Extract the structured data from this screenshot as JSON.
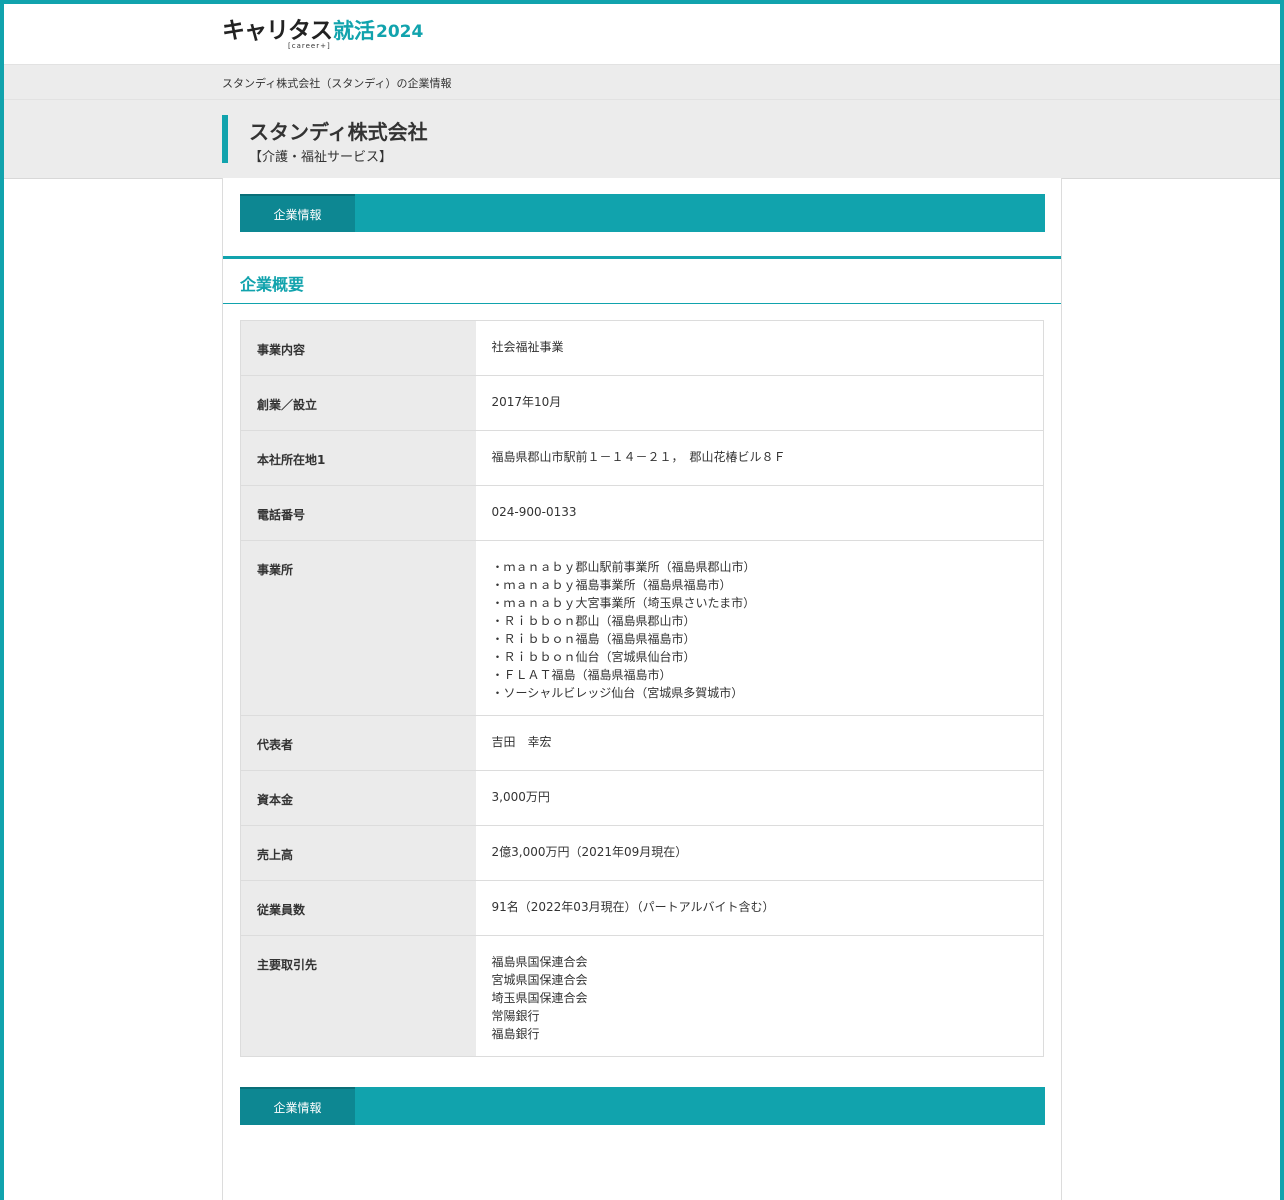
{
  "logo": {
    "main": "キャリタス",
    "sub": "[career+]",
    "accent": "就活",
    "year": "2024"
  },
  "breadcrumb": "スタンディ株式会社（スタンディ）の企業情報",
  "company": {
    "name": "スタンディ株式会社",
    "industry": "【介護・福祉サービス】"
  },
  "tabs": {
    "top": {
      "active": "企業情報"
    },
    "bottom": {
      "active": "企業情報"
    }
  },
  "section_title": "企業概要",
  "rows": [
    {
      "label": "事業内容",
      "value": "社会福祉事業"
    },
    {
      "label": "創業／設立",
      "value": "2017年10月"
    },
    {
      "label": "本社所在地1",
      "value": "福島県郡山市駅前１－１４－２１，　郡山花椿ビル８Ｆ"
    },
    {
      "label": "電話番号",
      "value": "024-900-0133"
    },
    {
      "label": "事業所",
      "lines": [
        "・ｍａｎａｂｙ郡山駅前事業所（福島県郡山市）",
        "・ｍａｎａｂｙ福島事業所（福島県福島市）",
        "・ｍａｎａｂｙ大宮事業所（埼玉県さいたま市）",
        "・Ｒｉｂｂｏｎ郡山（福島県郡山市）",
        "・Ｒｉｂｂｏｎ福島（福島県福島市）",
        "・Ｒｉｂｂｏｎ仙台（宮城県仙台市）",
        "・ＦＬＡＴ福島（福島県福島市）",
        "・ソーシャルビレッジ仙台（宮城県多賀城市）"
      ]
    },
    {
      "label": "代表者",
      "value": "吉田　幸宏"
    },
    {
      "label": "資本金",
      "value": "3,000万円"
    },
    {
      "label": "売上高",
      "value": "2億3,000万円（2021年09月現在）"
    },
    {
      "label": "従業員数",
      "value": "91名（2022年03月現在）（パートアルバイト含む）"
    },
    {
      "label": "主要取引先",
      "lines": [
        "福島県国保連合会",
        "宮城県国保連合会",
        "埼玉県国保連合会",
        "常陽銀行",
        "福島銀行"
      ]
    }
  ]
}
